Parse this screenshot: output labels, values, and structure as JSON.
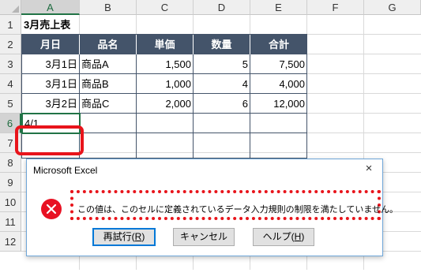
{
  "columns": [
    "A",
    "B",
    "C",
    "D",
    "E",
    "F",
    "G"
  ],
  "rows": [
    "1",
    "2",
    "3",
    "4",
    "5",
    "6",
    "7",
    "8",
    "9",
    "10",
    "11",
    "12"
  ],
  "title_cell": "3月売上表",
  "table": {
    "headers": [
      "月日",
      "品名",
      "単価",
      "数量",
      "合計"
    ],
    "rows": [
      [
        "3月1日",
        "商品A",
        "1,500",
        "5",
        "7,500"
      ],
      [
        "3月1日",
        "商品B",
        "1,000",
        "4",
        "4,000"
      ],
      [
        "3月2日",
        "商品C",
        "2,000",
        "6",
        "12,000"
      ]
    ]
  },
  "active_cell_value": "4/1",
  "dialog": {
    "title": "Microsoft Excel",
    "close": "×",
    "message": "この値は、このセルに定義されているデータ入力規則の制限を満たしていません。",
    "retry_label": "再試行(",
    "retry_key": "R",
    "cancel_label": "キャンセル",
    "help_label": "ヘルプ(",
    "help_key": "H",
    "paren_close": ")"
  },
  "colors": {
    "table_header_bg": "#44546a",
    "highlight_red": "#e8141b",
    "excel_green": "#217346",
    "error_icon": "#e81123"
  }
}
